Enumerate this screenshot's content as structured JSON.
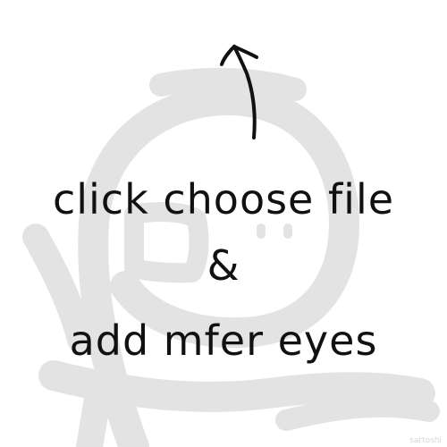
{
  "instruction": {
    "line1": "click choose file",
    "line2": "&",
    "line3": "add mfer eyes"
  },
  "signature": "sartoshi",
  "colors": {
    "background": "#ffffff",
    "ink": "#111111",
    "watermark": "#e3e3e3"
  },
  "icons": {
    "arrow": "arrow-up-icon",
    "background": "mfer-face-watermark"
  }
}
